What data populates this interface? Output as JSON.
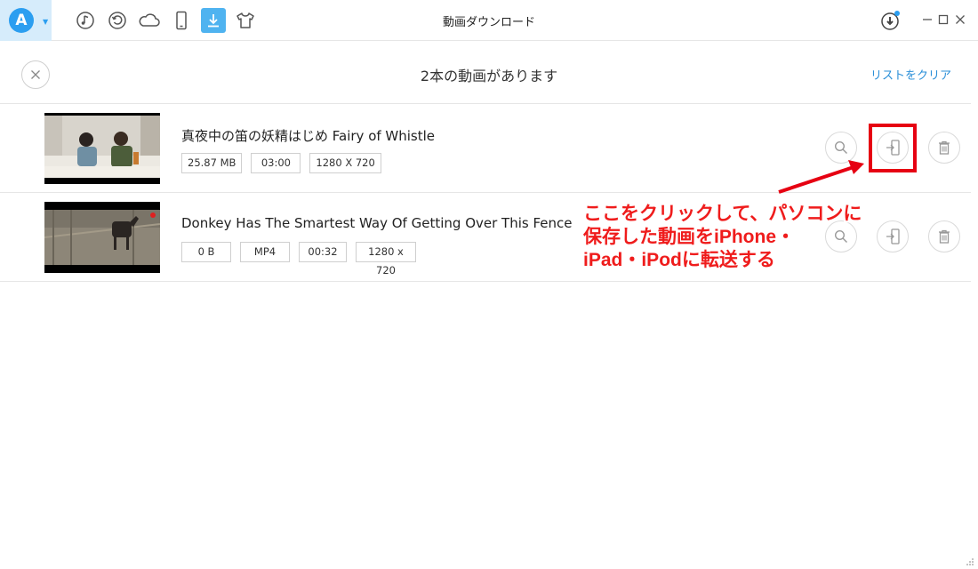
{
  "window": {
    "title": "動画ダウンロード",
    "app_logo_letter": "A"
  },
  "nav": [
    {
      "name": "music-icon",
      "active": false
    },
    {
      "name": "restore-icon",
      "active": false
    },
    {
      "name": "cloud-icon",
      "active": false
    },
    {
      "name": "device-icon",
      "active": false
    },
    {
      "name": "download-icon",
      "active": true
    },
    {
      "name": "tshirt-icon",
      "active": false
    }
  ],
  "header": {
    "title": "2本の動画があります",
    "clear_label": "リストをクリア"
  },
  "videos": [
    {
      "title": "真夜中の笛の妖精はじめ   Fairy of  Whistle",
      "size": "25.87 MB",
      "duration": "03:00",
      "resolution": "1280 X 720"
    },
    {
      "title": "Donkey Has The Smartest Way Of Getting Over This Fence",
      "size": "0 B",
      "format": "MP4",
      "duration": "00:32",
      "resolution": "1280 x 720"
    }
  ],
  "annotation": {
    "lines": [
      "ここをクリックして、パソコンに",
      "保存した動画をiPhone・",
      "iPad・iPodに転送する"
    ],
    "color": "#e60012"
  },
  "colors": {
    "accent": "#2b9ef0",
    "link": "#2b8fd8",
    "nav_active": "#4fb3f0"
  }
}
